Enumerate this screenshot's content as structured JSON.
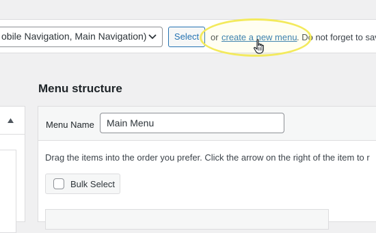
{
  "manage": {
    "selected_menu": "obile Navigation, Main Navigation)",
    "select_button": "Select",
    "or_text": "or",
    "create_link": "create a new menu",
    "after_text": ". Do not forget to sav"
  },
  "structure": {
    "title": "Menu structure",
    "menu_name_label": "Menu Name",
    "menu_name_value": "Main Menu",
    "instructions": "Drag the items into the order you prefer. Click the arrow on the right of the item to r",
    "bulk_select_label": "Bulk Select"
  },
  "colors": {
    "link": "#2271b1",
    "highlight": "#f3ea5d",
    "background": "#f0f0f1"
  },
  "icons": [
    "chevron-down-icon",
    "hand-cursor-icon",
    "collapse-arrow-icon"
  ]
}
